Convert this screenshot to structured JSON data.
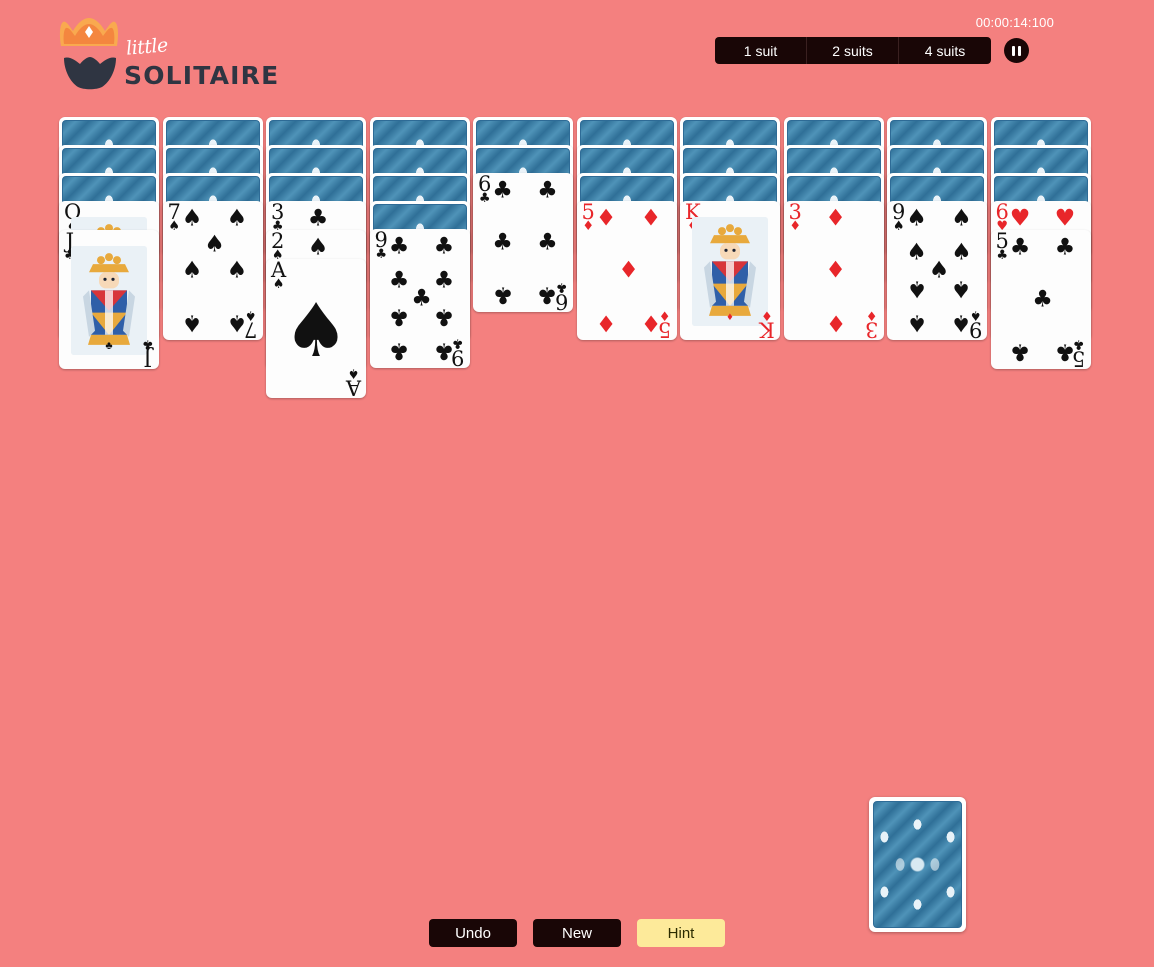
{
  "app": {
    "title_script": "little",
    "title_main": "SOLITAIRE",
    "background_color": "#f4807f"
  },
  "header": {
    "timer": "00:00:14:100",
    "difficulty_buttons": [
      {
        "label": "1 suit",
        "name": "difficulty-1-suit"
      },
      {
        "label": "2 suits",
        "name": "difficulty-2-suits"
      },
      {
        "label": "4 suits",
        "name": "difficulty-4-suits"
      }
    ],
    "pause_label": "Pause",
    "pause_icon": "pause-icon"
  },
  "colors": {
    "red_suit": "#e8262a",
    "black_suit": "#111111",
    "button_dark": "#190606",
    "hint_yellow": "#fdea9a",
    "card_back_blue": "#3e7fa8"
  },
  "tableau": {
    "columns": [
      {
        "facedown": 3,
        "faceup": [
          {
            "rank": "Q",
            "suit": "spades",
            "symbol": "♠",
            "color": "black",
            "court": true
          },
          {
            "rank": "J",
            "suit": "clubs",
            "symbol": "♣",
            "color": "black",
            "court": true
          }
        ]
      },
      {
        "facedown": 3,
        "faceup": [
          {
            "rank": "7",
            "suit": "spades",
            "symbol": "♠",
            "color": "black",
            "court": false
          }
        ]
      },
      {
        "facedown": 3,
        "faceup": [
          {
            "rank": "3",
            "suit": "clubs",
            "symbol": "♣",
            "color": "black",
            "court": false
          },
          {
            "rank": "2",
            "suit": "spades",
            "symbol": "♠",
            "color": "black",
            "court": false
          },
          {
            "rank": "A",
            "suit": "spades",
            "symbol": "♠",
            "color": "black",
            "court": false,
            "ace": true
          }
        ]
      },
      {
        "facedown": 4,
        "faceup": [
          {
            "rank": "9",
            "suit": "clubs",
            "symbol": "♣",
            "color": "black",
            "court": false
          }
        ]
      },
      {
        "facedown": 2,
        "faceup": [
          {
            "rank": "6",
            "suit": "clubs",
            "symbol": "♣",
            "color": "black",
            "court": false
          }
        ]
      },
      {
        "facedown": 3,
        "faceup": [
          {
            "rank": "5",
            "suit": "diamonds",
            "symbol": "♦",
            "color": "red",
            "court": false
          }
        ]
      },
      {
        "facedown": 3,
        "faceup": [
          {
            "rank": "K",
            "suit": "diamonds",
            "symbol": "♦",
            "color": "red",
            "court": true
          }
        ]
      },
      {
        "facedown": 3,
        "faceup": [
          {
            "rank": "3",
            "suit": "diamonds",
            "symbol": "♦",
            "color": "red",
            "court": false
          }
        ]
      },
      {
        "facedown": 3,
        "faceup": [
          {
            "rank": "9",
            "suit": "spades",
            "symbol": "♠",
            "color": "black",
            "court": false
          }
        ]
      },
      {
        "facedown": 3,
        "faceup": [
          {
            "rank": "6",
            "suit": "hearts",
            "symbol": "♥",
            "color": "red",
            "court": false
          },
          {
            "rank": "5",
            "suit": "clubs",
            "symbol": "♣",
            "color": "black",
            "court": false
          }
        ]
      }
    ]
  },
  "stock": {
    "name": "stock-pile",
    "piles_remaining": 1
  },
  "footer": {
    "buttons": [
      {
        "label": "Undo",
        "name": "undo-button",
        "style": "dark"
      },
      {
        "label": "New",
        "name": "new-button",
        "style": "dark"
      },
      {
        "label": "Hint",
        "name": "hint-button",
        "style": "hint"
      }
    ]
  }
}
